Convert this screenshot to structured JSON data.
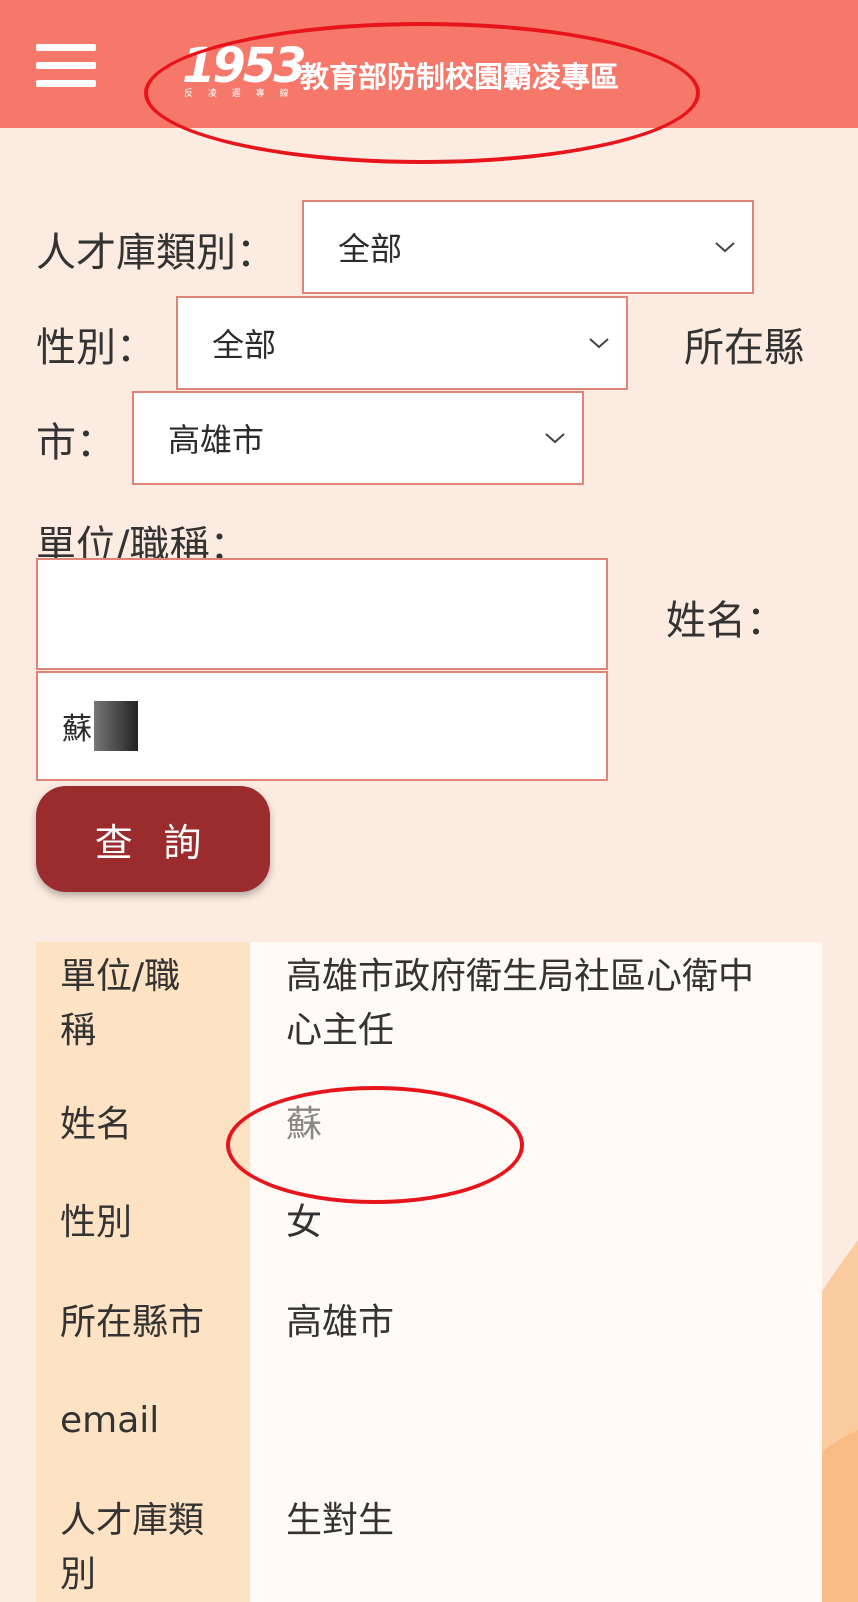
{
  "header": {
    "logo_number": "1953",
    "logo_subtext": "反 凌 遲 專 線",
    "title": "教育部防制校園霸凌專區"
  },
  "filters": {
    "category_label": "人才庫類別：",
    "category_value": "全部",
    "gender_label": "性別：",
    "gender_value": "全部",
    "county_label_part1": "所在縣",
    "county_label_part2": "市：",
    "county_value": "高雄市",
    "unit_label": "單位/職稱：",
    "unit_value": "",
    "name_label": "姓名：",
    "name_value": "蘇"
  },
  "query_button": "查 詢",
  "result": {
    "rows": [
      {
        "key_line1": "單位/職",
        "key_line2": "稱",
        "value_line1": "高雄市政府衛生局社區心衛中",
        "value_line2": "心主任"
      },
      {
        "key": "姓名",
        "value": "蘇"
      },
      {
        "key": "性別",
        "value": "女"
      },
      {
        "key": "所在縣市",
        "value": "高雄市"
      },
      {
        "key": "email",
        "value": ""
      },
      {
        "key_line1": "人才庫類",
        "key_line2": "別",
        "value_line1": "生對生"
      }
    ]
  },
  "colors": {
    "header": "#f5786a",
    "background": "#fcebe0",
    "button": "#9a2c2e",
    "field_border": "#e08478",
    "annotation": "#e8141b",
    "result_key_column": "#fde2c4"
  }
}
